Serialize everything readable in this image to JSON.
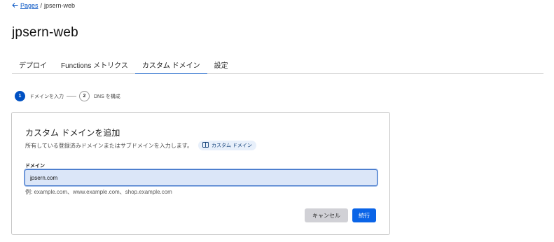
{
  "breadcrumb": {
    "back_label": "Pages",
    "separator": "/",
    "current": "jpsern-web"
  },
  "page": {
    "title": "jpsern-web"
  },
  "tabs": [
    {
      "label": "デプロイ",
      "active": false
    },
    {
      "label": "Functions メトリクス",
      "active": false
    },
    {
      "label": "カスタム ドメイン",
      "active": true
    },
    {
      "label": "設定",
      "active": false
    }
  ],
  "stepper": {
    "steps": [
      {
        "number": "1",
        "label": "ドメインを入力",
        "active": true
      },
      {
        "number": "2",
        "label": "DNS を構成",
        "active": false
      }
    ]
  },
  "card": {
    "title": "カスタム ドメインを追加",
    "description": "所有している登録済みドメインまたはサブドメインを入力します。",
    "doc_chip": "カスタム ドメイン",
    "field_label": "ドメイン",
    "input_value": "jpsern.com",
    "hint": "例: example.com、www.example.com、shop.example.com",
    "cancel_label": "キャンセル",
    "continue_label": "続行"
  },
  "colors": {
    "accent": "#0051c3",
    "primary_button": "#0a64e7",
    "secondary_button": "#d1d1d6",
    "input_focus_bg": "#dbe6f8"
  }
}
